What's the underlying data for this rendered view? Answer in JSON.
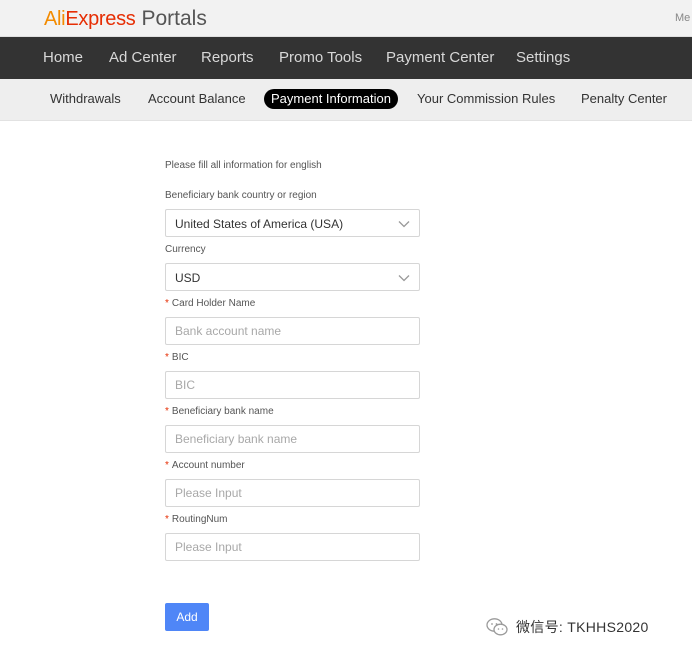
{
  "header": {
    "logo_brand_a": "Ali",
    "logo_brand_b": "Express",
    "logo_suffix": "Portals",
    "right_text": "Me"
  },
  "mainnav": {
    "items": [
      "Home",
      "Ad Center",
      "Reports",
      "Promo Tools",
      "Payment Center",
      "Settings"
    ]
  },
  "subnav": {
    "items": [
      "Withdrawals",
      "Account Balance",
      "Payment Information",
      "Your Commission Rules",
      "Penalty Center"
    ],
    "active": "Payment Information"
  },
  "form": {
    "note": "Please fill all information for english",
    "country_label": "Beneficiary bank country or region",
    "country_value": "United States of America (USA)",
    "currency_label": "Currency",
    "currency_value": "USD",
    "card_holder_label": "Card Holder Name",
    "card_holder_placeholder": "Bank account name",
    "bic_label": "BIC",
    "bic_placeholder": "BIC",
    "bank_name_label": "Beneficiary bank name",
    "bank_name_placeholder": "Beneficiary bank name",
    "account_number_label": "Account number",
    "account_number_placeholder": "Please Input",
    "routing_label": "RoutingNum",
    "routing_placeholder": "Please Input",
    "required_mark": "*",
    "add_label": "Add"
  },
  "watermark": {
    "text": "微信号: TKHHS2020"
  },
  "colors": {
    "nav_bg": "#333333",
    "subnav_bg": "#eeeeee",
    "primary_button": "#4f86f7",
    "brand_red": "#e62e04",
    "brand_orange": "#f38b00"
  }
}
